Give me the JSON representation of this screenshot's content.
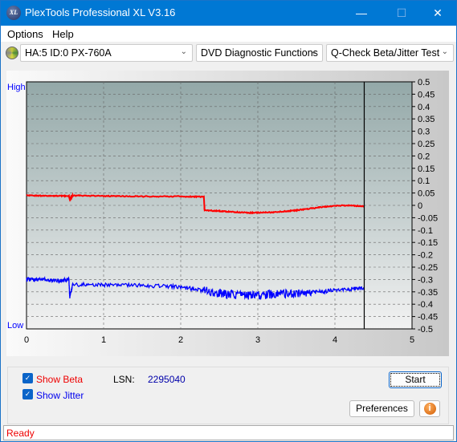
{
  "window": {
    "title": "PlexTools Professional XL V3.16",
    "logo": "XL",
    "minimize": "—",
    "maximize": "☐",
    "close": "✕"
  },
  "menu": [
    {
      "label": "Options"
    },
    {
      "label": "Help"
    }
  ],
  "toolbar": {
    "drive": "HA:5 ID:0  PX-760A",
    "function": "DVD Diagnostic Functions",
    "test": "Q-Check Beta/Jitter Test"
  },
  "chart_data": {
    "type": "line",
    "xlim": [
      0,
      5
    ],
    "ylim": [
      -0.5,
      0.5
    ],
    "x_ticks": [
      "0",
      "1",
      "2",
      "3",
      "4",
      "5"
    ],
    "y_ticks": [
      "0.5",
      "0.45",
      "0.4",
      "0.35",
      "0.3",
      "0.25",
      "0.2",
      "0.15",
      "0.1",
      "0.05",
      "0",
      "-0.05",
      "-0.1",
      "-0.15",
      "-0.2",
      "-0.25",
      "-0.3",
      "-0.35",
      "-0.4",
      "-0.45",
      "-0.5"
    ],
    "left_labels": {
      "top": "High",
      "bottom": "Low"
    },
    "grid": true,
    "end_marker_x": 4.38,
    "series": [
      {
        "key": "beta",
        "color": "#ff0000",
        "x": [
          0,
          0.3,
          0.55,
          0.56,
          0.6,
          1.0,
          1.5,
          2.0,
          2.3,
          2.31,
          2.6,
          2.9,
          3.2,
          3.5,
          3.8,
          4.1,
          4.38
        ],
        "y": [
          0.04,
          0.038,
          0.038,
          0.025,
          0.04,
          0.038,
          0.036,
          0.036,
          0.035,
          -0.02,
          -0.025,
          -0.03,
          -0.028,
          -0.02,
          -0.008,
          0,
          -0.003
        ]
      },
      {
        "key": "jitter",
        "color": "#0000ff",
        "x": [
          0,
          0.2,
          0.4,
          0.55,
          0.56,
          0.6,
          1.0,
          1.5,
          2.0,
          2.3,
          2.6,
          2.9,
          3.2,
          3.5,
          3.8,
          4.1,
          4.38
        ],
        "y": [
          -0.3,
          -0.3,
          -0.305,
          -0.3,
          -0.37,
          -0.32,
          -0.322,
          -0.325,
          -0.33,
          -0.345,
          -0.36,
          -0.365,
          -0.36,
          -0.355,
          -0.35,
          -0.34,
          -0.335
        ]
      }
    ]
  },
  "controls": {
    "show_beta": "Show Beta",
    "show_jitter": "Show Jitter",
    "beta_checked": true,
    "jitter_checked": true,
    "lsn_label": "LSN:",
    "lsn_value": "2295040",
    "start": "Start",
    "preferences": "Preferences",
    "info_icon": "info-icon"
  },
  "status": "Ready"
}
